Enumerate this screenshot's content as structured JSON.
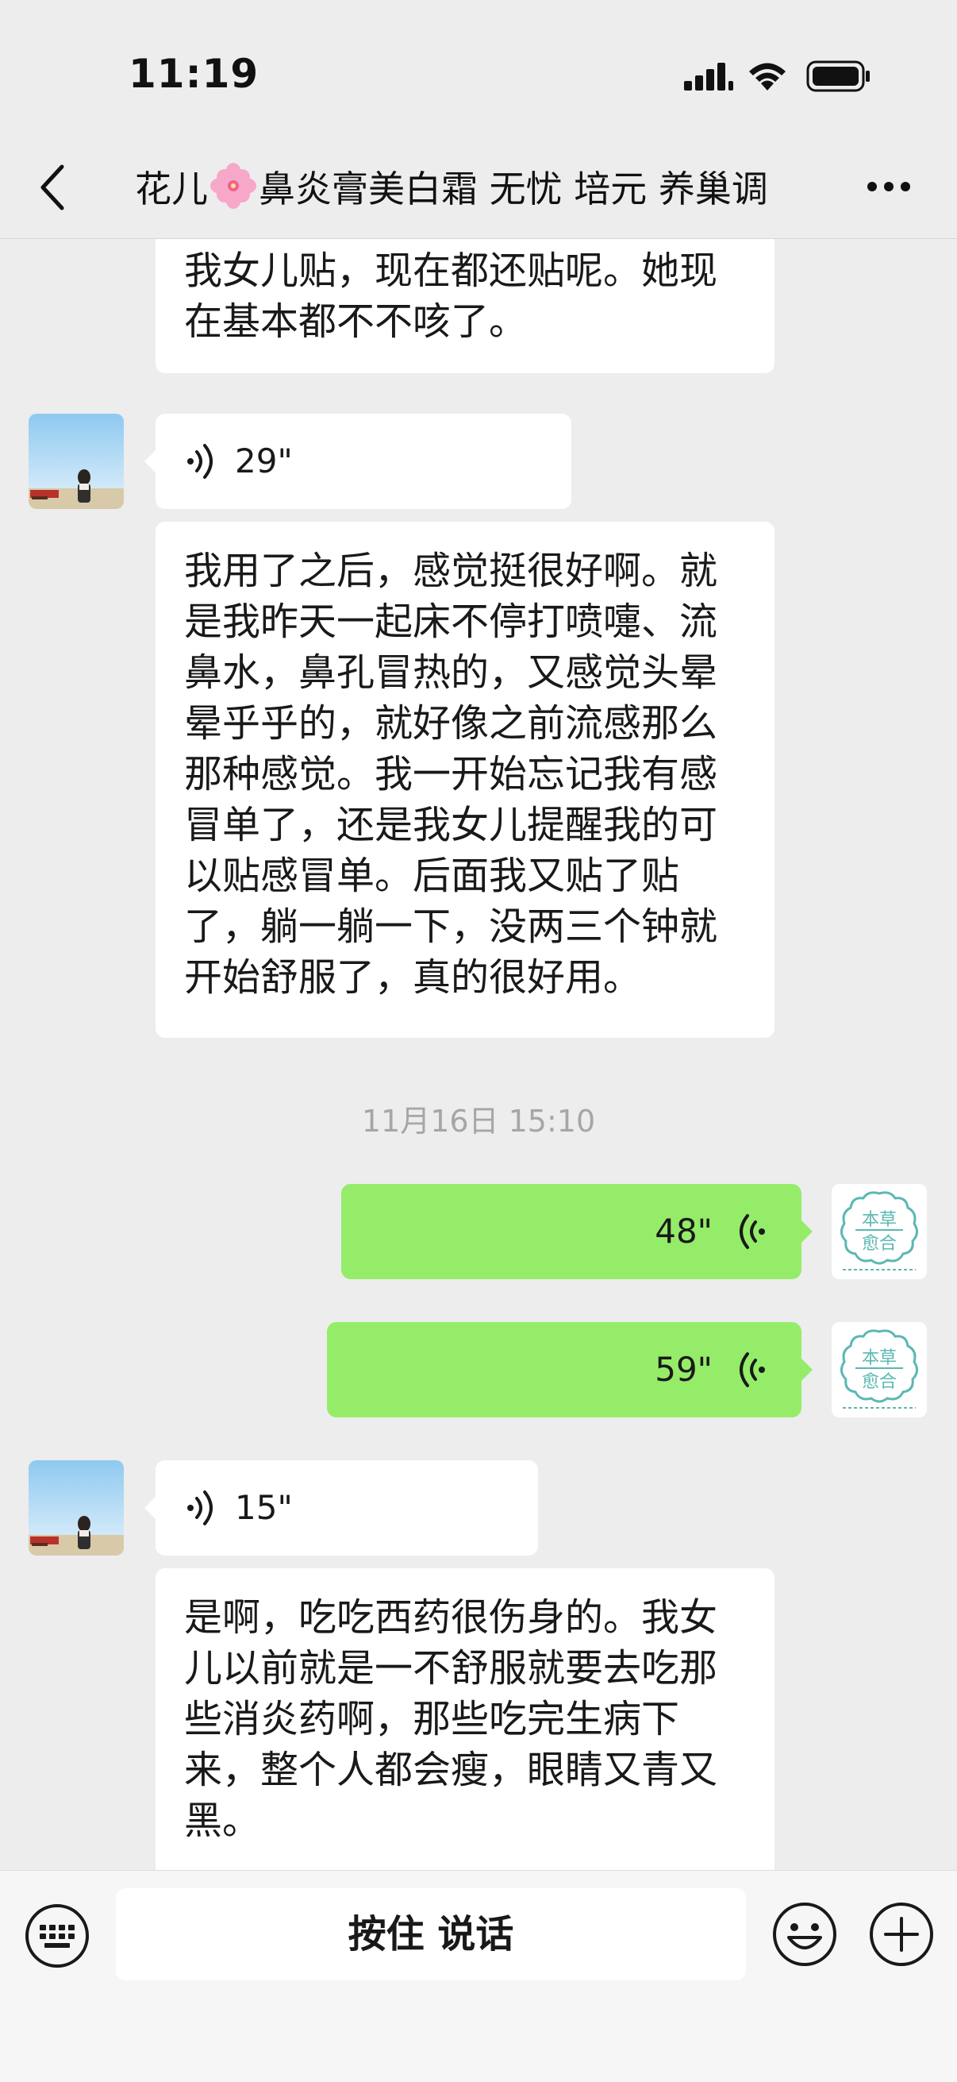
{
  "status_bar": {
    "time": "11:19"
  },
  "header": {
    "title_before_icon": "花儿",
    "title_icon": "flower-icon",
    "title_after_icon": "鼻炎膏美白霜 无忧 培元 养巢调"
  },
  "messages": [
    {
      "id": "m1",
      "side": "left",
      "type": "text",
      "text": "我女儿贴，现在都还贴呢。她现\n在基本都不不咳了。"
    },
    {
      "id": "m2",
      "side": "left",
      "type": "voice",
      "duration": "29\""
    },
    {
      "id": "m3",
      "side": "left",
      "type": "text",
      "text": "我用了之后，感觉挺很好啊。就\n是我昨天一起床不停打喷嚏、流\n鼻水，鼻孔冒热的，又感觉头晕\n晕乎乎的，就好像之前流感那么\n那种感觉。我一开始忘记我有感\n冒单了，还是我女儿提醒我的可\n以贴感冒单。后面我又贴了贴\n了，躺一躺一下，没两三个钟就\n开始舒服了，真的很好用。"
    },
    {
      "id": "ts1",
      "type": "timestamp",
      "text": "11月16日 15:10"
    },
    {
      "id": "m4",
      "side": "right",
      "type": "voice",
      "duration": "48\""
    },
    {
      "id": "m5",
      "side": "right",
      "type": "voice",
      "duration": "59\""
    },
    {
      "id": "m6",
      "side": "left",
      "type": "voice",
      "duration": "15\""
    },
    {
      "id": "m7",
      "side": "left",
      "type": "text",
      "text": "是啊，吃吃西药很伤身的。我女\n儿以前就是一不舒服就要去吃那\n些消炎药啊，那些吃完生病下\n来，整个人都会瘦，眼睛又青又\n黑。"
    }
  ],
  "store_avatar": {
    "line1": "本草",
    "line2": "愈合"
  },
  "input_bar": {
    "hold_to_talk": "按住 说话"
  },
  "colors": {
    "background": "#ededed",
    "bubble_self": "#95ec69",
    "bubble_other": "#ffffff",
    "timestamp": "#a6a6a6",
    "store_avatar_accent": "#5bb8b3"
  }
}
